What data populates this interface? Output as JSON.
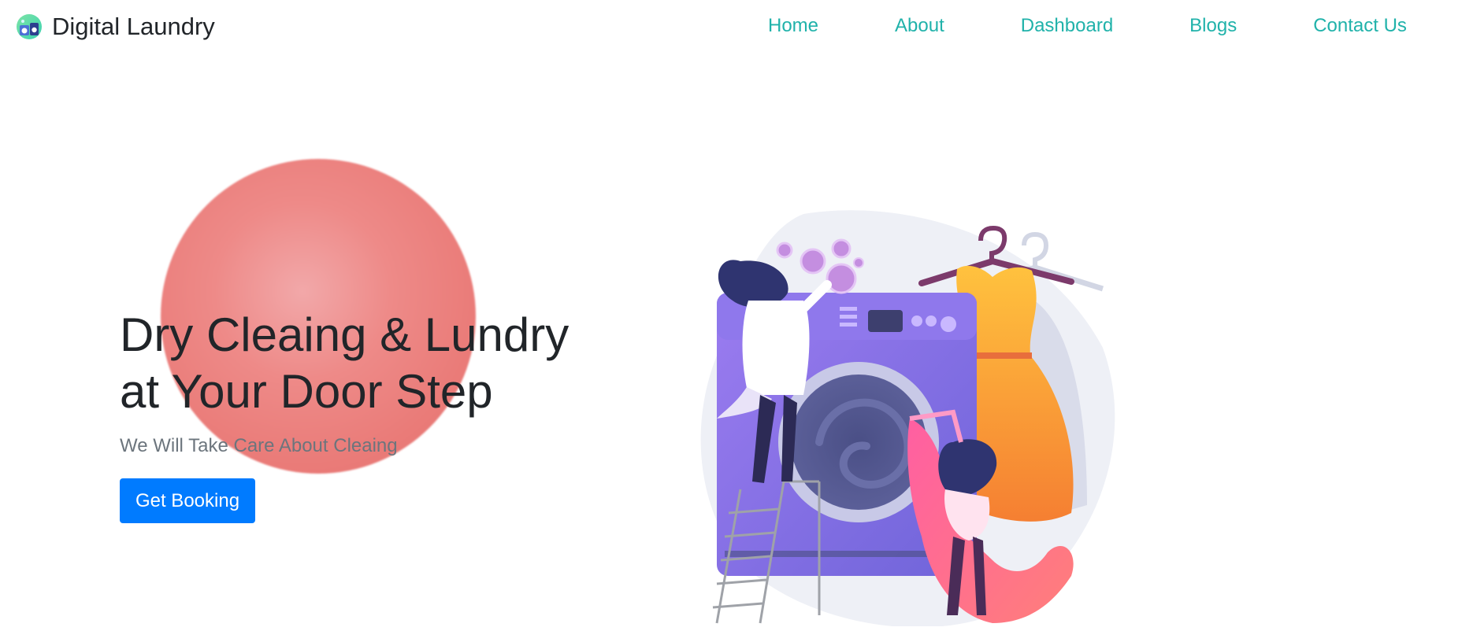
{
  "brand": {
    "name": "Digital Laundry",
    "logo_icon": "laundry-logo-icon"
  },
  "nav": {
    "items": [
      {
        "label": "Home"
      },
      {
        "label": "About"
      },
      {
        "label": "Dashboard"
      },
      {
        "label": "Blogs"
      },
      {
        "label": "Contact Us"
      }
    ]
  },
  "hero": {
    "title_line1": "Dry Cleaing & Lundry",
    "title_line2": "at Your Door Step",
    "subtitle": "We Will Take Care About Cleaing",
    "cta_label": "Get Booking",
    "illustration_icon": "washing-machine-illustration"
  },
  "colors": {
    "nav_link": "#20b2aa",
    "button": "#007bff",
    "blob": "#ee8a88",
    "title": "#212529",
    "subtitle": "#6c757d"
  }
}
